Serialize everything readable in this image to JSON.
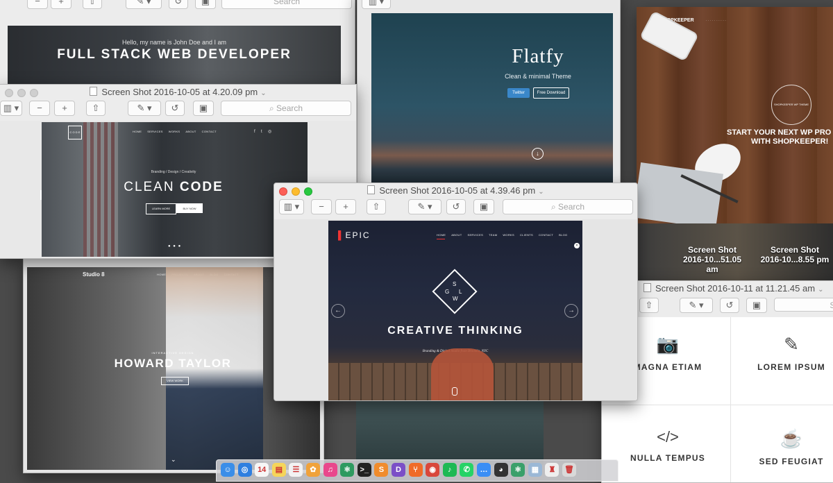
{
  "windows": {
    "top_left": {
      "search_placeholder": "Search"
    },
    "john_doe": {
      "intro": "Hello, my name is John Doe and I am",
      "headline": "FULL STACK WEB DEVELOPER"
    },
    "clean_code_window": {
      "title": "Screen Shot 2016-10-05 at 4.20.09 pm",
      "search_placeholder": "Search",
      "logo_text": "C O D E",
      "nav": [
        "HOME",
        "SERVICES",
        "WORKS",
        "ABOUT",
        "CONTACT"
      ],
      "social": [
        "f",
        "t",
        "◎"
      ],
      "tagline": "Branding / Design / Creativity",
      "headline_light": "CLEAN",
      "headline_bold": "CODE",
      "btn_learn": "LEARN MORE",
      "btn_buy": "BUY NOW"
    },
    "flatfy": {
      "title": "Flatfy",
      "subtitle": "Clean & minimal Theme",
      "btn_twitter": "Twitter",
      "btn_download": "Free Download"
    },
    "shopkeeper": {
      "logo": "SHOPKEEPER",
      "badge": "SHOPKEEPER WP THEME",
      "headline_1": "START YOUR NEXT WP PRO",
      "headline_2": "WITH SHOPKEEPER!"
    },
    "desktop_icons": [
      {
        "line1": "Screen Shot",
        "line2": "2016-10...51.05 am"
      },
      {
        "line1": "Screen Shot",
        "line2": "2016-10...8.55 pm"
      }
    ],
    "features_window": {
      "title": "Screen Shot 2016-10-11 at 11.21.45 am",
      "search_placeholder": "Se",
      "items": [
        {
          "icon": "camera-icon",
          "glyph": "📷",
          "label": "MAGNA ETIAM"
        },
        {
          "icon": "pencil-icon",
          "glyph": "✎",
          "label": "LOREM IPSUM"
        },
        {
          "icon": "code-icon",
          "glyph": "</>",
          "label": "NULLA TEMPUS"
        },
        {
          "icon": "cup-icon",
          "glyph": "☕",
          "label": "SED FEUGIAT"
        }
      ]
    },
    "studio8": {
      "logo": "Studio 8",
      "nav": [
        "HOME",
        "PROJECTS",
        "ABOUT",
        "BLOG",
        "CONTACT"
      ],
      "kicker": "INTERACTIVE DESIGN",
      "headline": "HOWARD TAYLOR",
      "button": "VIEW WORK"
    },
    "epic_window": {
      "title": "Screen Shot 2016-10-05 at 4.39.46 pm",
      "search_placeholder": "Search",
      "logo": "EPIC",
      "nav": [
        "HOME",
        "ABOUT",
        "SERVICES",
        "TEAM",
        "WORKS",
        "CLIENTS",
        "CONTACT",
        "BLOG"
      ],
      "diamond_letters": [
        "S",
        "G",
        "L",
        "W"
      ],
      "headline": "CREATIVE THINKING",
      "subline": "Branding & Digital Studio from Brooklin, NYC"
    }
  },
  "dock": {
    "items": [
      {
        "name": "finder",
        "glyph": "☺",
        "color": "#3b8ee8"
      },
      {
        "name": "safari",
        "glyph": "◎",
        "color": "#2f7fe0"
      },
      {
        "name": "calendar",
        "glyph": "14",
        "color": "#f6f6f6"
      },
      {
        "name": "notes",
        "glyph": "▤",
        "color": "#f5d55a"
      },
      {
        "name": "reminders",
        "glyph": "☰",
        "color": "#f2f2f2"
      },
      {
        "name": "photos",
        "glyph": "✿",
        "color": "#f0a23a"
      },
      {
        "name": "itunes",
        "glyph": "♫",
        "color": "#e9478c"
      },
      {
        "name": "atom",
        "glyph": "⚛",
        "color": "#2e9a60"
      },
      {
        "name": "terminal",
        "glyph": ">_",
        "color": "#222222"
      },
      {
        "name": "sublime",
        "glyph": "S",
        "color": "#f08c2d"
      },
      {
        "name": "dash",
        "glyph": "D",
        "color": "#7b4fc7"
      },
      {
        "name": "sourcetree",
        "glyph": "⑂",
        "color": "#f06b28"
      },
      {
        "name": "chrome",
        "glyph": "◉",
        "color": "#d9473b"
      },
      {
        "name": "spotify",
        "glyph": "♪",
        "color": "#1db954"
      },
      {
        "name": "whatsapp",
        "glyph": "✆",
        "color": "#25d366"
      },
      {
        "name": "messages",
        "glyph": "…",
        "color": "#3a8ef5"
      },
      {
        "name": "github",
        "glyph": "◕",
        "color": "#333333"
      },
      {
        "name": "atom-2",
        "glyph": "⚛",
        "color": "#3aa06a"
      },
      {
        "name": "preview",
        "glyph": "▦",
        "color": "#9bb8d6"
      },
      {
        "name": "unknown",
        "glyph": "♜",
        "color": "#eeeeee"
      },
      {
        "name": "trash",
        "glyph": "🗑",
        "color": "#d9d9d9"
      }
    ]
  }
}
